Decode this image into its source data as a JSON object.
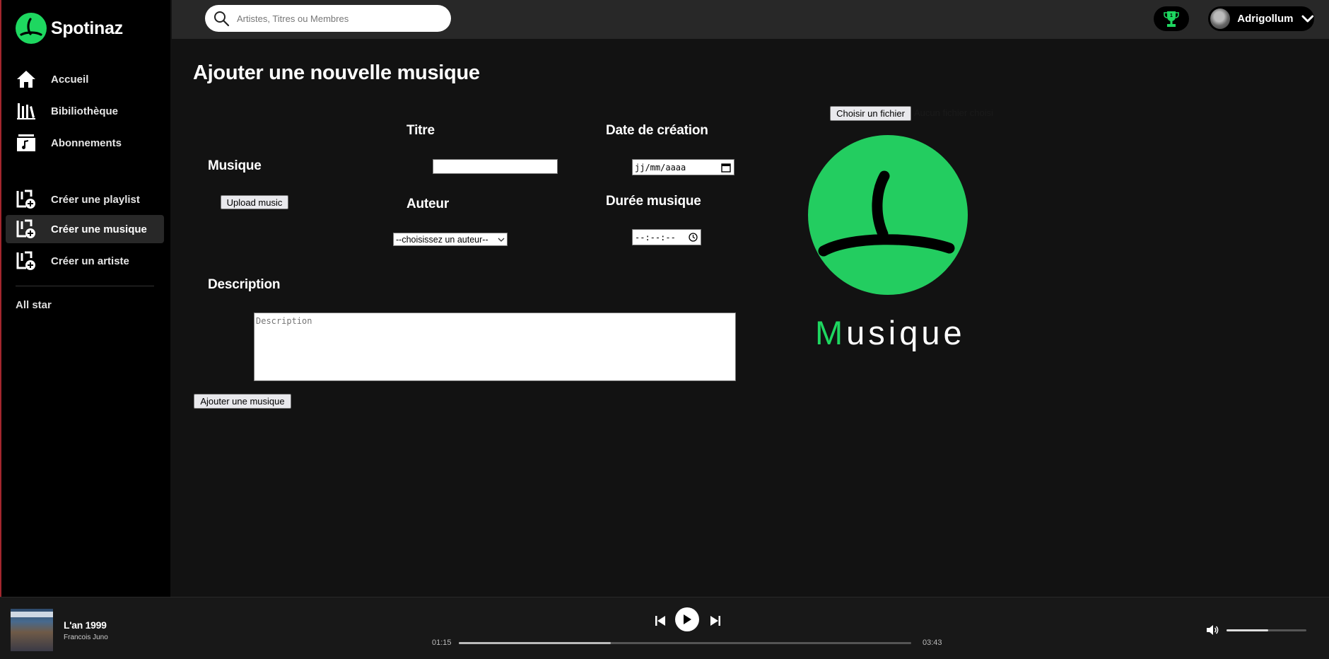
{
  "brand": {
    "name": "Spotinaz",
    "accent": "#1ed760"
  },
  "header": {
    "search_placeholder": "Artistes, Titres ou Membres",
    "trophy_icon": "trophy-icon",
    "user_name": "Adrigollum"
  },
  "sidebar": {
    "items": [
      {
        "label": "Accueil",
        "icon": "home-icon"
      },
      {
        "label": "Bibiliothèque",
        "icon": "library-icon"
      },
      {
        "label": "Abonnements",
        "icon": "music-note-icon"
      },
      {
        "label": "Créer une playlist",
        "icon": "add-collection-icon"
      },
      {
        "label": "Créer une musique",
        "icon": "add-collection-icon",
        "active": true
      },
      {
        "label": "Créer un artiste",
        "icon": "add-collection-icon"
      }
    ],
    "section": "All star"
  },
  "form": {
    "title": "Ajouter une nouvelle musique",
    "label_musique": "Musique",
    "upload_button": "Upload music",
    "label_titre": "Titre",
    "titre_value": "",
    "label_auteur": "Auteur",
    "auteur_selected": "--choisissez un auteur--",
    "label_date": "Date de création",
    "date_value": "jj/mm/aaaa",
    "label_duree": "Durée musique",
    "duree_value": "--:--:--",
    "label_description": "Description",
    "description_placeholder": "Description",
    "submit": "Ajouter une musique",
    "file_button": "Choisir un fichier",
    "file_status": "Aucun fichier choisi",
    "preview_label_first": "M",
    "preview_label_rest": "usique"
  },
  "player": {
    "song_title": "L'an 1999",
    "artist": "Francois Juno",
    "time_current": "01:15",
    "time_total": "03:43",
    "progress": 0.336,
    "volume": 0.52
  }
}
